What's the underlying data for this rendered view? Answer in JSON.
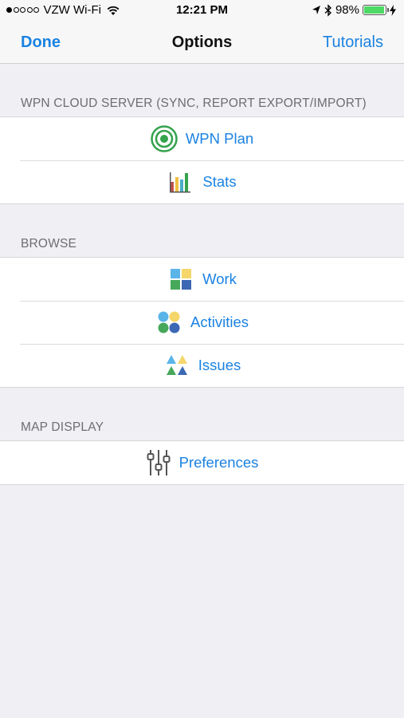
{
  "status_bar": {
    "carrier": "VZW Wi-Fi",
    "time": "12:21 PM",
    "battery_percent": "98%",
    "battery_level": 0.98
  },
  "nav": {
    "left": "Done",
    "title": "Options",
    "right": "Tutorials"
  },
  "sections": [
    {
      "header": "WPN CLOUD SERVER (SYNC, REPORT EXPORT/IMPORT)",
      "items": [
        {
          "label": "WPN Plan",
          "icon": "target-icon"
        },
        {
          "label": "Stats",
          "icon": "bar-chart-icon"
        }
      ]
    },
    {
      "header": "BROWSE",
      "items": [
        {
          "label": "Work",
          "icon": "squares-icon"
        },
        {
          "label": "Activities",
          "icon": "circles-icon"
        },
        {
          "label": "Issues",
          "icon": "triangles-icon"
        }
      ]
    },
    {
      "header": "MAP DISPLAY",
      "items": [
        {
          "label": "Preferences",
          "icon": "sliders-icon"
        }
      ]
    }
  ]
}
